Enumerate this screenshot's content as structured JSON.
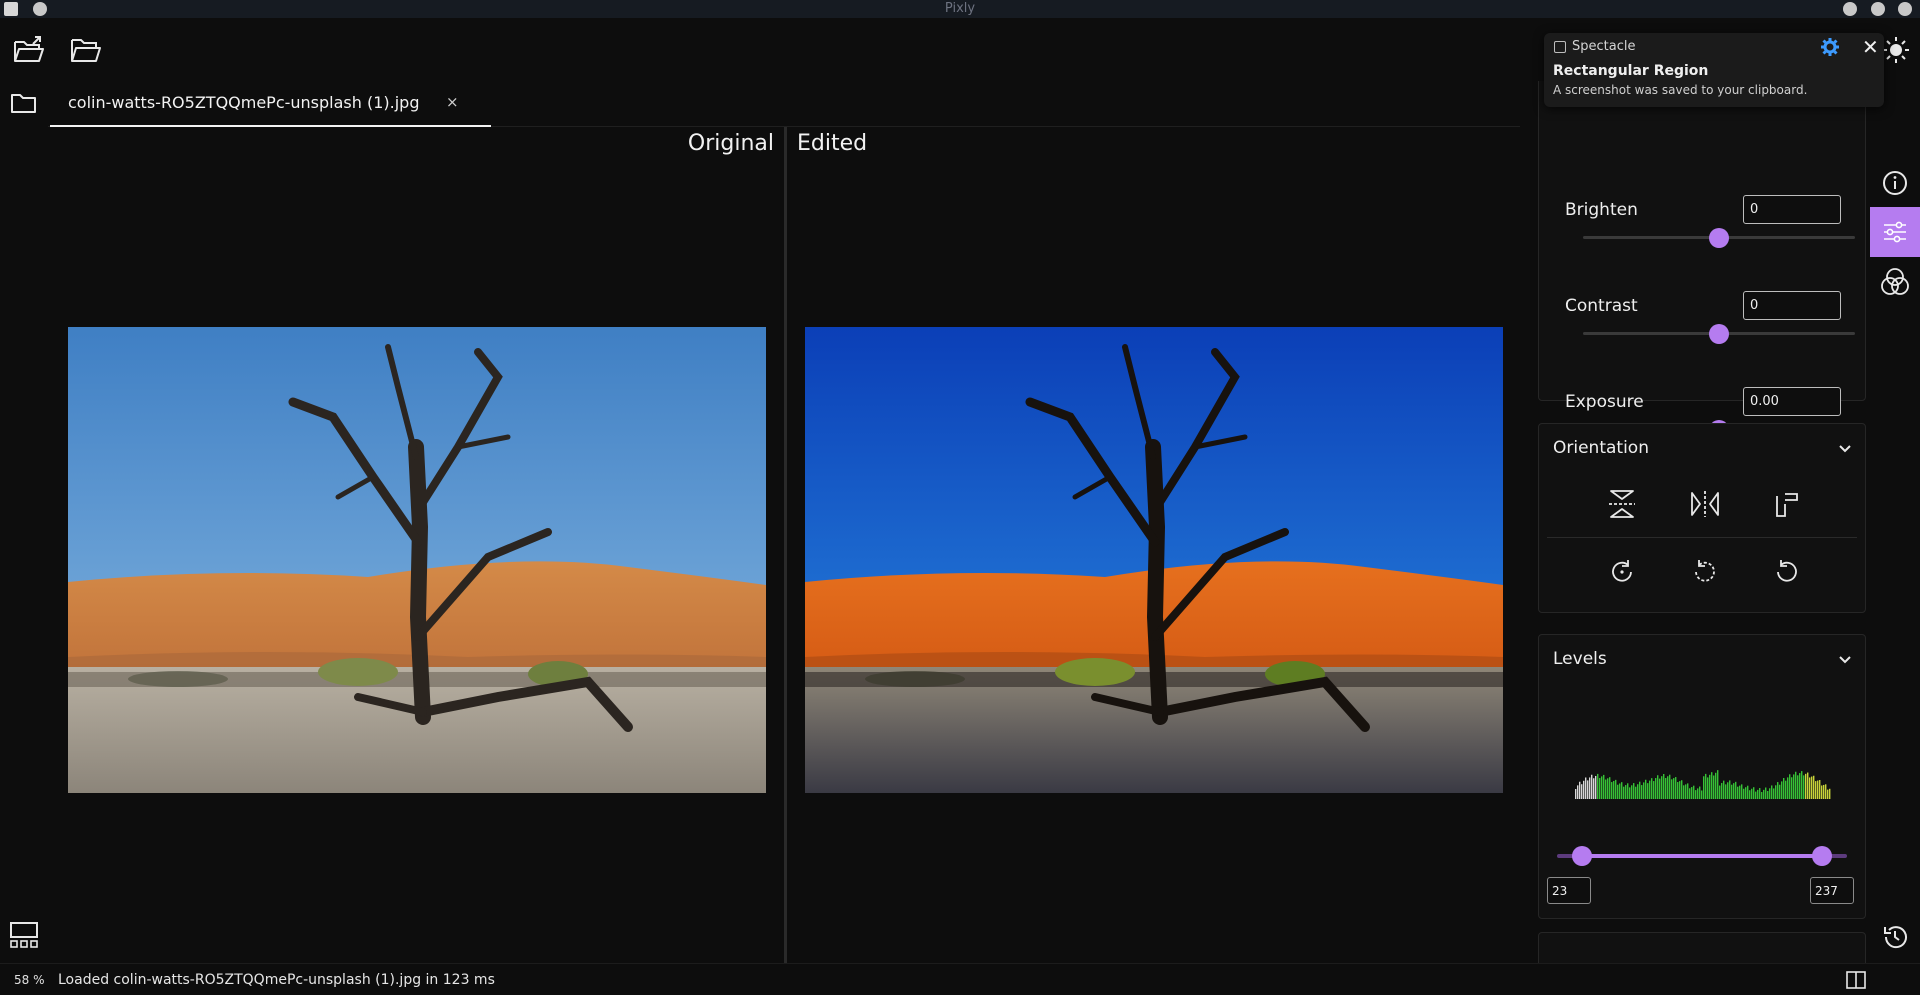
{
  "window": {
    "title": "Pixly"
  },
  "tab": {
    "filename": "colin-watts-RO5ZTQQmePc-unsplash (1).jpg",
    "close_glyph": "×"
  },
  "viewer": {
    "original_label": "Original",
    "edited_label": "Edited"
  },
  "adjustments": {
    "brighten": {
      "label": "Brighten",
      "value": "0",
      "level": 0.5
    },
    "contrast": {
      "label": "Contrast",
      "value": "0",
      "level": 0.5
    },
    "exposure": {
      "label": "Exposure",
      "value": "0.00",
      "level": 0.5
    }
  },
  "orientation": {
    "title": "Orientation",
    "buttons": [
      "flip-vertical-icon",
      "flip-horizontal-icon",
      "rotate-free-icon",
      "rotate-cw-icon",
      "rotate-ccw-icon",
      "rotate-reset-icon"
    ]
  },
  "levels": {
    "title": "Levels",
    "low": "23",
    "high": "237"
  },
  "notification": {
    "app": "Spectacle",
    "heading": "Rectangular Region",
    "body": "A screenshot was saved to your clipboard.",
    "close_glyph": "✕"
  },
  "statusbar": {
    "zoom": "58 %",
    "message": "Loaded colin-watts-RO5ZTQQmePc-unsplash (1).jpg in 123 ms"
  },
  "colors": {
    "accent": "#b57cf0",
    "background": "#0d0d0d"
  }
}
